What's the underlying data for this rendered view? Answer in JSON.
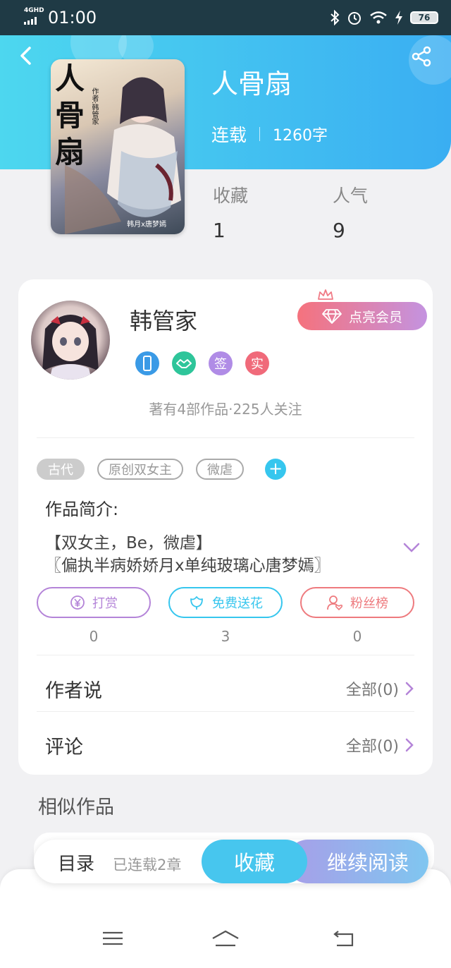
{
  "status_bar": {
    "network": "4GHD",
    "time": "01:00",
    "battery": "76"
  },
  "header": {
    "back_icon": "back-arrow-icon",
    "share_icon": "share-icon"
  },
  "book": {
    "cover_title": "人骨扇",
    "cover_author": "作者:韩管家",
    "cover_bottom": "韩月x唐梦嫣",
    "title": "人骨扇",
    "status": "连载",
    "word_count": "1260字",
    "stats": [
      {
        "label": "收藏",
        "value": "1"
      },
      {
        "label": "人气",
        "value": "9"
      }
    ]
  },
  "author": {
    "name": "韩管家",
    "vip_button": "点亮会员",
    "badges": [
      {
        "icon": "phone-badge-icon",
        "text": "",
        "color": "#3a9ae6"
      },
      {
        "icon": "handshake-badge-icon",
        "text": "",
        "color": "#2ec59a"
      },
      {
        "icon": "sign-badge-icon",
        "text": "签",
        "color": "#b08ce6"
      },
      {
        "icon": "verified-badge-icon",
        "text": "实",
        "color": "#f06a7a"
      }
    ],
    "info": "著有4部作品·225人关注"
  },
  "tags": [
    "古代",
    "原创双女主",
    "微虐"
  ],
  "intro": {
    "heading": "作品简介:",
    "line1": "【双女主，Be，微虐】",
    "line2": "〖偏执半病娇娇月x单纯玻璃心唐梦嫣〗"
  },
  "actions": [
    {
      "label": "打赏",
      "count": "0",
      "icon": "yen-icon",
      "color": "#b484d8"
    },
    {
      "label": "免费送花",
      "count": "3",
      "icon": "flower-icon",
      "color": "#36c6ee"
    },
    {
      "label": "粉丝榜",
      "count": "0",
      "icon": "fan-rank-icon",
      "color": "#ee7a7e"
    }
  ],
  "rows": [
    {
      "title": "作者说",
      "all": "全部(0)"
    },
    {
      "title": "评论",
      "all": "全部(0)"
    }
  ],
  "similar_title": "相似作品",
  "bottom_bar": {
    "toc": "目录",
    "updated": "已连载2章",
    "collect": "收藏",
    "continue": "继续阅读"
  },
  "colors": {
    "header_start": "#4dd7ef",
    "header_end": "#3aaef2",
    "accent": "#36c6ee",
    "chevron": "#b484d8"
  }
}
